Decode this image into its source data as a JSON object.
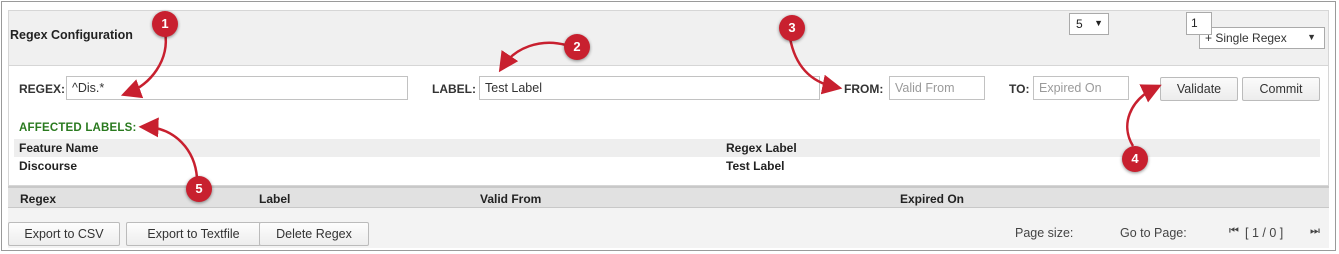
{
  "header": {
    "title": "Regex Configuration",
    "mode_select": "+ Single Regex"
  },
  "form": {
    "regex_label": "REGEX:",
    "regex_value": "^Dis.*",
    "label_label": "LABEL:",
    "label_value": "Test Label",
    "from_label": "FROM:",
    "from_placeholder": "Valid From",
    "to_label": "TO:",
    "to_placeholder": "Expired On",
    "validate": "Validate",
    "commit": "Commit"
  },
  "affected": {
    "title": "AFFECTED LABELS:",
    "columns": [
      "Feature Name",
      "Regex Label"
    ],
    "rows": [
      [
        "Discourse",
        "Test Label"
      ]
    ]
  },
  "grid": {
    "columns": [
      "Regex",
      "Label",
      "Valid From",
      "Expired On"
    ]
  },
  "footer": {
    "export_csv": "Export to CSV",
    "export_text": "Export to Textfile",
    "delete": "Delete Regex",
    "page_size_label": "Page size:",
    "page_size_value": "5",
    "goto_label": "Go to Page:",
    "goto_value": "1",
    "page_info": "[ 1 / 0 ]"
  },
  "annotations": [
    "1",
    "2",
    "3",
    "4",
    "5"
  ],
  "colors": {
    "annotation": "#c8202f",
    "affected_title": "#2a7a1f",
    "header_bg": "#f0f0f0"
  }
}
